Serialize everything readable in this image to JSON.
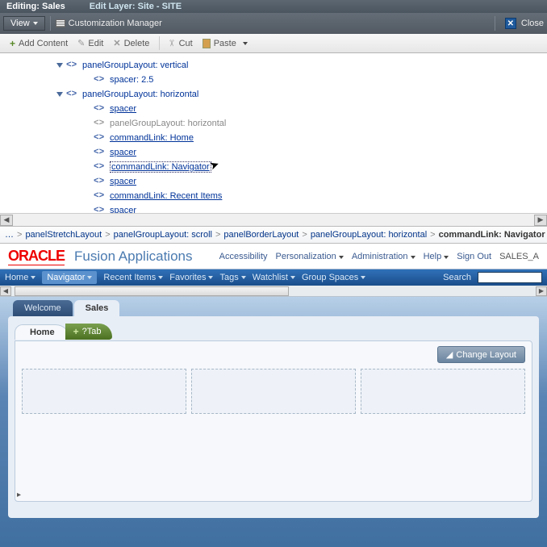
{
  "header": {
    "editing": "Editing: Sales",
    "layer": "Edit Layer: Site - SITE"
  },
  "toolbar1": {
    "view": "View",
    "cm": "Customization Manager",
    "close": "Close"
  },
  "toolbar2": {
    "add": "Add Content",
    "edit": "Edit",
    "delete": "Delete",
    "cut": "Cut",
    "paste": "Paste"
  },
  "tree": [
    {
      "indent": 80,
      "expand": true,
      "tag": "<>",
      "label": "panelGroupLayout: vertical",
      "link": false
    },
    {
      "indent": 112,
      "tag": "<>",
      "label": "spacer: 2.5",
      "link": false
    },
    {
      "indent": 80,
      "expand": true,
      "tag": "<>",
      "label": "panelGroupLayout: horizontal",
      "link": false
    },
    {
      "indent": 112,
      "tag": "<>",
      "label": "spacer",
      "link": true
    },
    {
      "indent": 112,
      "tag": "<>",
      "gray": true,
      "label": "panelGroupLayout: horizontal",
      "link": false
    },
    {
      "indent": 112,
      "tag": "<>",
      "label": "commandLink: Home",
      "link": true
    },
    {
      "indent": 112,
      "tag": "<>",
      "label": "spacer",
      "link": true
    },
    {
      "indent": 112,
      "tag": "<>",
      "label": "commandLink: Navigator",
      "link": true,
      "selected": true
    },
    {
      "indent": 112,
      "tag": "<>",
      "label": "spacer",
      "link": true
    },
    {
      "indent": 112,
      "tag": "<>",
      "label": "commandLink: Recent Items",
      "link": true
    },
    {
      "indent": 112,
      "tag": "<>",
      "label": "spacer",
      "link": true
    }
  ],
  "breadcrumb": {
    "dots": "…",
    "items": [
      "panelStretchLayout",
      "panelGroupLayout: scroll",
      "panelBorderLayout",
      "panelGroupLayout: horizontal"
    ],
    "current": "commandLink: Navigator"
  },
  "oracle": {
    "logo": "ORACLE",
    "app": "Fusion Applications",
    "links": {
      "accessibility": "Accessibility",
      "personalization": "Personalization",
      "administration": "Administration",
      "help": "Help",
      "signout": "Sign Out"
    },
    "user": "SALES_A"
  },
  "nav": {
    "items": [
      "Home",
      "Navigator",
      "Recent Items",
      "Favorites",
      "Tags",
      "Watchlist",
      "Group Spaces"
    ],
    "active_index": 1,
    "search": "Search"
  },
  "main_tabs": {
    "inactive": "Welcome",
    "active": "Sales"
  },
  "sub_tabs": {
    "home": "Home",
    "add": "?Tab"
  },
  "change_layout": "Change Layout"
}
